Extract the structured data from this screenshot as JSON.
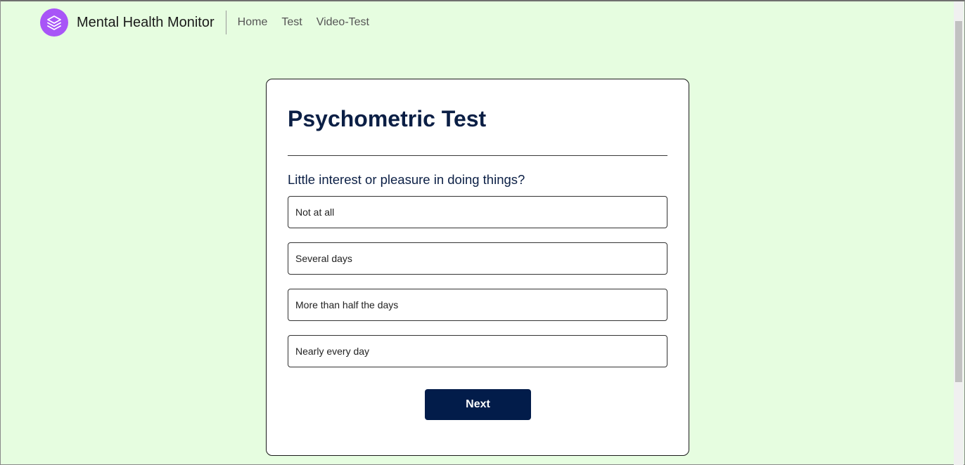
{
  "header": {
    "brand": "Mental Health Monitor",
    "logo_icon": "layers-icon",
    "nav": [
      "Home",
      "Test",
      "Video-Test"
    ]
  },
  "card": {
    "title": "Psychometric Test",
    "question": "Little interest or pleasure in doing things?",
    "options": [
      "Not at all",
      "Several days",
      "More than half the days",
      "Nearly every day"
    ],
    "next_label": "Next"
  },
  "colors": {
    "page_background": "#e6fde0",
    "accent": "#a855f7",
    "primary": "#021c4a"
  }
}
